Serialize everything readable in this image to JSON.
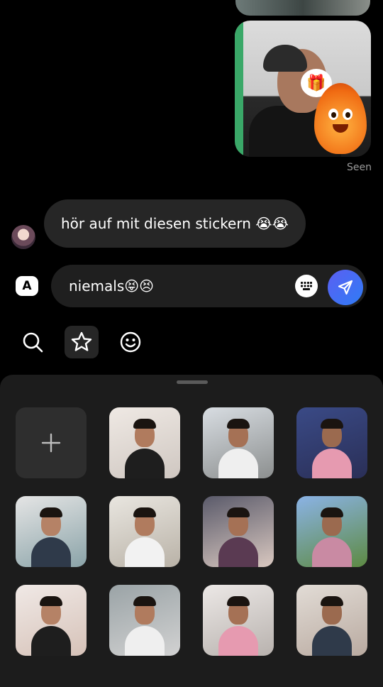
{
  "chat": {
    "seen_label": "Seen",
    "received_message": "hör auf mit diesen stickern 😭😭"
  },
  "composer": {
    "text": "niemals😝😣"
  },
  "colors": {
    "background": "#000000",
    "bubble_received": "#262626",
    "composer_bg": "#1f1f1f",
    "sheet_bg": "#1c1c1c",
    "send_gradient_start": "#5b5ff2",
    "send_gradient_end": "#2f7cf6"
  },
  "icons": {
    "composer_left": "keyboard-switch-A-icon",
    "composer_right": "keyboard-icon",
    "send": "paper-plane-icon",
    "tabs": [
      "search-icon",
      "star-icon",
      "smiley-icon"
    ],
    "add_sticker": "plus-icon"
  },
  "stickers": {
    "rows_visible": 3,
    "tiles": [
      {
        "kind": "add"
      },
      {
        "kind": "photo"
      },
      {
        "kind": "photo"
      },
      {
        "kind": "photo"
      },
      {
        "kind": "photo"
      },
      {
        "kind": "photo"
      },
      {
        "kind": "photo"
      },
      {
        "kind": "photo"
      },
      {
        "kind": "photo"
      },
      {
        "kind": "photo"
      },
      {
        "kind": "photo"
      },
      {
        "kind": "photo"
      }
    ]
  }
}
